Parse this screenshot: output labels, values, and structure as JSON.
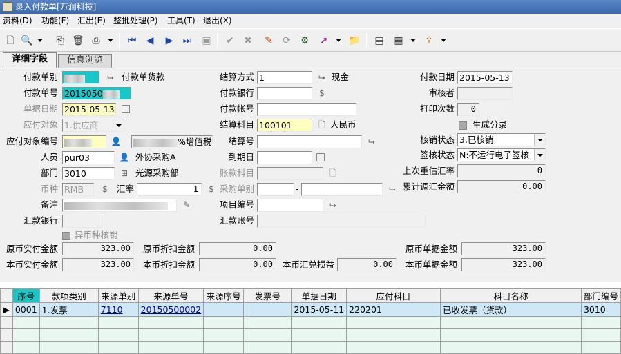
{
  "window": {
    "title": "录入付款单[万润科技]"
  },
  "menu": [
    "资料(D)",
    "功能(F)",
    "汇出(E)",
    "整批处理(P)",
    "工具(T)",
    "退出(X)"
  ],
  "tabs": [
    {
      "label": "详细字段"
    },
    {
      "label": "信息浏览"
    }
  ],
  "form": {
    "payment_type_label": "付款单别",
    "payment_type_name": "付款单货款",
    "payment_no_label": "付款单号",
    "payment_no_value": "2015050",
    "doc_date_label": "单据日期",
    "doc_date_value": "2015-05-13",
    "payable_obj_label": "应付对象",
    "payable_obj_value": "1.供应商",
    "payable_obj_no_label": "应付对象编号",
    "payable_obj_name_suffix": "%增值税",
    "person_label": "人员",
    "person_value": "pur03",
    "person_name": "外协采购A",
    "dept_label": "部门",
    "dept_value": "3010",
    "dept_name": "光源采购部",
    "currency_label": "币种",
    "currency_value": "RMB",
    "rate_label": "汇率",
    "rate_value": "1",
    "note_label": "备注",
    "remit_bank_label": "汇款银行",
    "foreign_writeoff_label": "异币种核销",
    "settle_method_label": "结算方式",
    "settle_method_value": "1",
    "settle_method_name": "现金",
    "pay_bank_label": "付款银行",
    "pay_account_label": "付款帐号",
    "settle_subject_label": "结算科目",
    "settle_subject_value": "100101",
    "settle_subject_name": "人民币",
    "settle_no_label": "结算号",
    "due_date_label": "到期日",
    "account_subject_label": "账款科目",
    "purchase_type_label": "采购单别",
    "project_no_label": "项目编号",
    "remit_account_label": "汇款账号",
    "pay_date_label": "付款日期",
    "pay_date_value": "2015-05-13",
    "auditor_label": "审核者",
    "print_count_label": "打印次数",
    "print_count_value": "0",
    "gen_entry_label": "生成分录",
    "writeoff_status_label": "核销状态",
    "writeoff_status_value": "3.已核销",
    "sign_status_label": "签核状态",
    "sign_status_value": "N:不运行电子签核",
    "last_revalue_label": "上次重估汇率",
    "last_revalue_value": "0",
    "cum_adjust_label": "累计调汇金额",
    "cum_adjust_value": "0.00",
    "orig_actual_label": "原币实付金额",
    "orig_actual_value": "323.00",
    "local_actual_label": "本币实付金额",
    "local_actual_value": "323.00",
    "orig_discount_label": "原币折扣金额",
    "orig_discount_value": "0.00",
    "local_discount_label": "本币折扣金额",
    "local_discount_value": "0.00",
    "fx_gain_label": "本币汇兑损益",
    "fx_gain_value": "0.00",
    "orig_doc_label": "原币单据金额",
    "orig_doc_value": "323.00",
    "local_doc_label": "本币单据金额",
    "local_doc_value": "323.00"
  },
  "grid": {
    "headers": [
      "序号",
      "款项类别",
      "来源单别",
      "来源单号",
      "来源序号",
      "发票号",
      "单据日期",
      "应付科目",
      "科目名称",
      "部门编号"
    ],
    "rows": [
      {
        "seq": "0001",
        "category": "1.发票",
        "src_type": "7110",
        "src_no": "20150500002",
        "src_seq": "",
        "invoice": "",
        "date": "2015-05-11",
        "subject": "220201",
        "subject_name": "已收发票（货款）",
        "dept": "3010"
      }
    ]
  }
}
